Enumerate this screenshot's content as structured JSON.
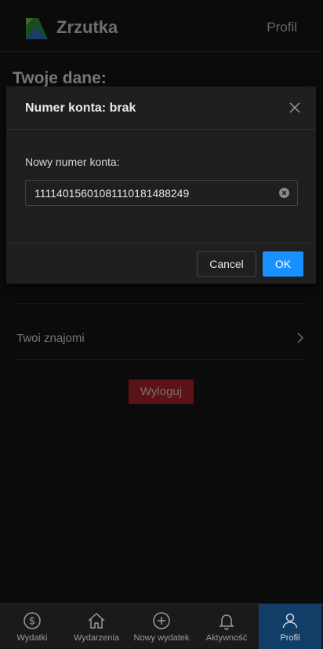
{
  "header": {
    "app_title": "Zrzutka",
    "profile_link": "Profil"
  },
  "page": {
    "title": "Twoje dane:",
    "friends_label": "Twoi znajomi",
    "logout_label": "Wyloguj"
  },
  "modal": {
    "title": "Numer konta: brak",
    "field_label": "Nowy numer konta:",
    "field_value": "11114015601081110181488249",
    "cancel_label": "Cancel",
    "ok_label": "OK"
  },
  "bottom_nav": {
    "items": [
      {
        "label": "Wydatki",
        "icon": "dollar-circle-icon"
      },
      {
        "label": "Wydarzenia",
        "icon": "home-icon"
      },
      {
        "label": "Nowy wydatek",
        "icon": "plus-circle-icon"
      },
      {
        "label": "Aktywność",
        "icon": "bell-icon"
      },
      {
        "label": "Profil",
        "icon": "user-icon"
      }
    ],
    "active_index": 4
  },
  "colors": {
    "accent": "#1890ff",
    "danger": "#a8242c",
    "active_tab": "#123d66"
  }
}
